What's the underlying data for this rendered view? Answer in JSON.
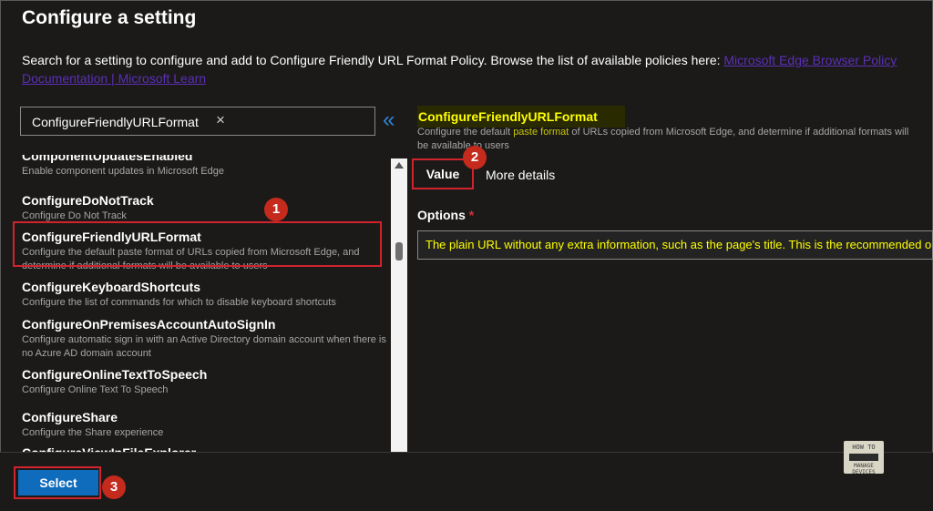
{
  "panel": {
    "title": "Configure a setting",
    "description_text": "Search for a setting to configure and add to Configure Friendly URL Format Policy. Browse the list of available policies here: ",
    "description_link": "Microsoft Edge Browser Policy Documentation | Microsoft Learn"
  },
  "search": {
    "value": "ConfigureFriendlyURLFormat",
    "clear_icon": "×",
    "collapse_icon": "«"
  },
  "settings": [
    {
      "name": "ComponentUpdatesEnabled",
      "desc": "Enable component updates in Microsoft Edge"
    },
    {
      "name": "ConfigureDoNotTrack",
      "desc": "Configure Do Not Track"
    },
    {
      "name": "ConfigureFriendlyURLFormat",
      "desc": "Configure the default paste format of URLs copied from Microsoft Edge, and determine if additional formats will be available to users"
    },
    {
      "name": "ConfigureKeyboardShortcuts",
      "desc": "Configure the list of commands for which to disable keyboard shortcuts"
    },
    {
      "name": "ConfigureOnPremisesAccountAutoSignIn",
      "desc": "Configure automatic sign in with an Active Directory domain account when there is no Azure AD domain account"
    },
    {
      "name": "ConfigureOnlineTextToSpeech",
      "desc": "Configure Online Text To Speech"
    },
    {
      "name": "ConfigureShare",
      "desc": "Configure the Share experience"
    },
    {
      "name": "ConfigureViewInFileExplorer",
      "desc": ""
    }
  ],
  "detail": {
    "title": "ConfigureFriendlyURLFormat",
    "desc_before": "Configure the default ",
    "desc_highlight": "paste format",
    "desc_after": " of URLs copied from Microsoft Edge, and determine if additional formats will be available to users",
    "tabs": [
      "Value",
      "More details"
    ],
    "options_label": "Options",
    "required_mark": "*",
    "options_value": "The plain URL without any extra information, such as the page's title. This is the recommended option"
  },
  "badges": [
    "1",
    "2",
    "3"
  ],
  "footer": {
    "select_label": "Select"
  },
  "watermark": {
    "top": "HOW TO",
    "bottom": "MANAGE DEVICES"
  },
  "colors": {
    "accent": "#0f6cbd",
    "highlight": "#ffff00",
    "annotation": "#d0232c",
    "link": "#5b2fb5"
  }
}
